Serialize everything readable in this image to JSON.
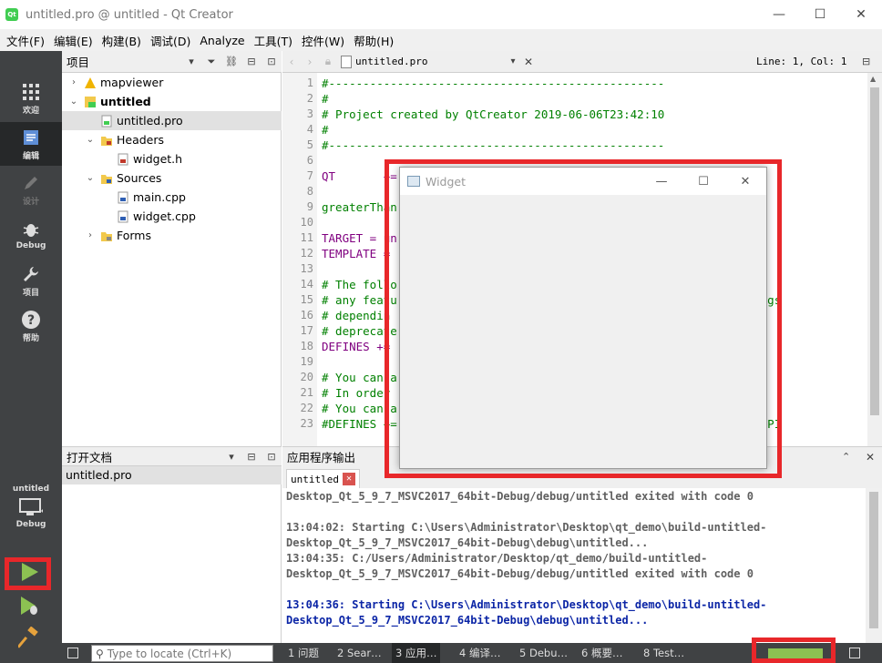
{
  "window": {
    "title": "untitled.pro @ untitled - Qt Creator",
    "logo_text": "Qt"
  },
  "menu": [
    "文件(F)",
    "编辑(E)",
    "构建(B)",
    "调试(D)",
    "Analyze",
    "工具(T)",
    "控件(W)",
    "帮助(H)"
  ],
  "modes": [
    {
      "label": "欢迎",
      "icon": "grid-icon"
    },
    {
      "label": "编辑",
      "icon": "edit-doc-icon"
    },
    {
      "label": "设计",
      "icon": "pencil-icon"
    },
    {
      "label": "Debug",
      "icon": "bug-icon"
    },
    {
      "label": "项目",
      "icon": "wrench-icon"
    },
    {
      "label": "帮助",
      "icon": "help-icon"
    }
  ],
  "kit": {
    "project": "untitled",
    "config": "Debug"
  },
  "projects_pane": {
    "title": "项目",
    "tree": [
      {
        "label": "mapviewer",
        "arrow": "›",
        "icon": "warning-icon"
      },
      {
        "label": "untitled",
        "arrow": "⌄",
        "icon": "qt-project-icon"
      },
      {
        "label": "untitled.pro",
        "arrow": "",
        "icon": "pro-file-icon"
      },
      {
        "label": "Headers",
        "arrow": "⌄",
        "icon": "h-folder-icon"
      },
      {
        "label": "widget.h",
        "arrow": "",
        "icon": "h-file-icon"
      },
      {
        "label": "Sources",
        "arrow": "⌄",
        "icon": "cpp-folder-icon"
      },
      {
        "label": "main.cpp",
        "arrow": "",
        "icon": "cpp-file-icon"
      },
      {
        "label": "widget.cpp",
        "arrow": "",
        "icon": "cpp-file-icon"
      },
      {
        "label": "Forms",
        "arrow": "›",
        "icon": "forms-folder-icon"
      }
    ]
  },
  "open_docs": {
    "title": "打开文档",
    "items": [
      "untitled.pro"
    ]
  },
  "editor": {
    "filename": "untitled.pro",
    "position": "Line: 1, Col: 1",
    "lines": [
      {
        "n": "1",
        "text": "#-------------------------------------------------",
        "cls": "c-cmt"
      },
      {
        "n": "2",
        "text": "#",
        "cls": "c-cmt"
      },
      {
        "n": "3",
        "text": "# Project created by QtCreator 2019-06-06T23:42:10",
        "cls": "c-cmt"
      },
      {
        "n": "4",
        "text": "#",
        "cls": "c-cmt"
      },
      {
        "n": "5",
        "text": "#-------------------------------------------------",
        "cls": "c-cmt"
      },
      {
        "n": "6",
        "text": "",
        "cls": ""
      },
      {
        "n": "7",
        "text": "QT       +=",
        "cls": "c-kw"
      },
      {
        "n": "8",
        "text": "",
        "cls": ""
      },
      {
        "n": "9",
        "text": "greaterThan",
        "cls": "c-cmt"
      },
      {
        "n": "10",
        "text": "",
        "cls": ""
      },
      {
        "n": "11",
        "text": "TARGET = un",
        "cls": "c-kw"
      },
      {
        "n": "12",
        "text": "TEMPLATE =",
        "cls": "c-kw"
      },
      {
        "n": "13",
        "text": "",
        "cls": ""
      },
      {
        "n": "14",
        "text": "# The follo                                          ou use",
        "cls": "c-cmt"
      },
      {
        "n": "15",
        "text": "# any featu                                          exact warnings",
        "cls": "c-cmt"
      },
      {
        "n": "16",
        "text": "# dependin                                           of the",
        "cls": "c-cmt"
      },
      {
        "n": "17",
        "text": "# deprecate                                          from it.",
        "cls": "c-cmt"
      },
      {
        "n": "18",
        "text": "DEFINES +=",
        "cls": "c-kw"
      },
      {
        "n": "19",
        "text": "",
        "cls": ""
      },
      {
        "n": "20",
        "text": "# You can a                                          ecated APIs.",
        "cls": "c-cmt"
      },
      {
        "n": "21",
        "text": "# In order",
        "cls": "c-cmt"
      },
      {
        "n": "22",
        "text": "# You can a                                          ertain versi",
        "cls": "c-cmt"
      },
      {
        "n": "23",
        "text": "#DEFINES +=                                          es all the API",
        "cls": "c-cmt"
      }
    ]
  },
  "output_pane": {
    "title": "应用程序输出",
    "tab": "untitled",
    "lines": [
      {
        "text": "Desktop_Qt_5_9_7_MSVC2017_64bit-Debug/debug/untitled exited with code 0",
        "cls": "out-gray"
      },
      {
        "text": "",
        "cls": ""
      },
      {
        "text": "13:04:02: Starting C:\\Users\\Administrator\\Desktop\\qt_demo\\build-untitled-",
        "cls": "out-gray"
      },
      {
        "text": "Desktop_Qt_5_9_7_MSVC2017_64bit-Debug\\debug\\untitled...",
        "cls": "out-gray"
      },
      {
        "text": "13:04:35: C:/Users/Administrator/Desktop/qt_demo/build-untitled-",
        "cls": "out-gray"
      },
      {
        "text": "Desktop_Qt_5_9_7_MSVC2017_64bit-Debug/debug/untitled exited with code 0",
        "cls": "out-gray"
      },
      {
        "text": "",
        "cls": ""
      },
      {
        "text": "13:04:36: Starting C:\\Users\\Administrator\\Desktop\\qt_demo\\build-untitled-",
        "cls": "out-blue"
      },
      {
        "text": "Desktop_Qt_5_9_7_MSVC2017_64bit-Debug\\debug\\untitled...",
        "cls": "out-blue"
      }
    ]
  },
  "widget_window": {
    "title": "Widget"
  },
  "statusbar": {
    "locator_placeholder": "Type to locate (Ctrl+K)",
    "tabs": [
      "1 问题",
      "2 Sear…",
      "3 应用…",
      "4 编译…",
      "5 Debu…",
      "6 概要…",
      "8 Test…"
    ],
    "build_progress": 1.0
  },
  "colors": {
    "annotation_red": "#e8272a",
    "progress_green": "#8cc152",
    "sidebar_dark": "#404244"
  }
}
